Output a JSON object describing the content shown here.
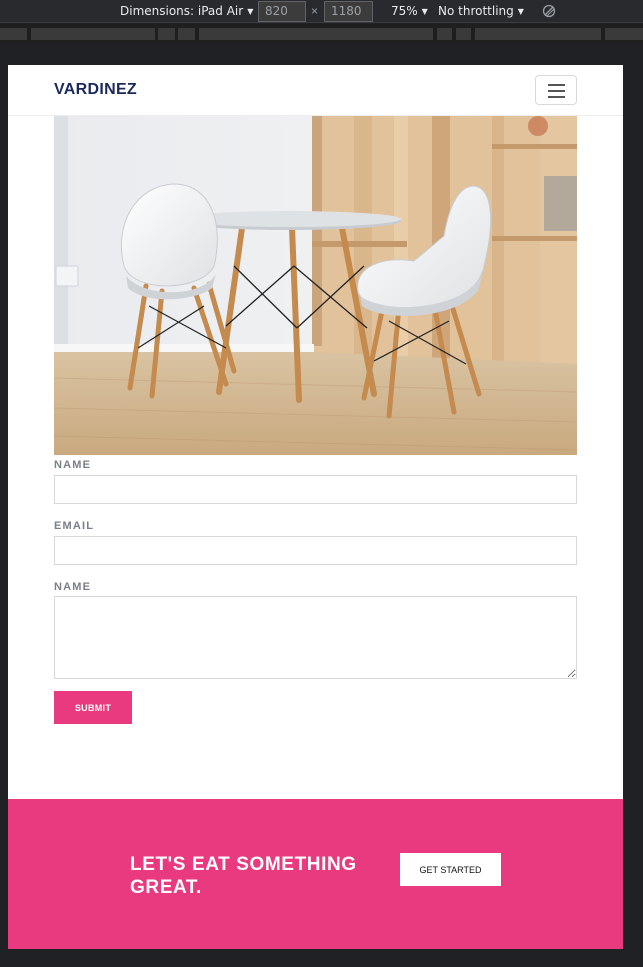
{
  "devtools": {
    "device_label": "Dimensions: iPad Air",
    "width_value": "820",
    "times_symbol": "×",
    "height_value": "1180",
    "zoom_label": "75%",
    "throttle_label": "No throttling"
  },
  "nav": {
    "brand": "VARDINEZ"
  },
  "form": {
    "name_label": "NAME",
    "email_label": "EMAIL",
    "message_label": "NAME",
    "submit_label": "SUBMIT"
  },
  "cta": {
    "heading": "LET'S EAT SOMETHING GREAT.",
    "button_label": "GET STARTED"
  },
  "colors": {
    "accent": "#ea3a7f",
    "brand": "#1b2a5a",
    "devtools_bg": "#292a2d"
  }
}
